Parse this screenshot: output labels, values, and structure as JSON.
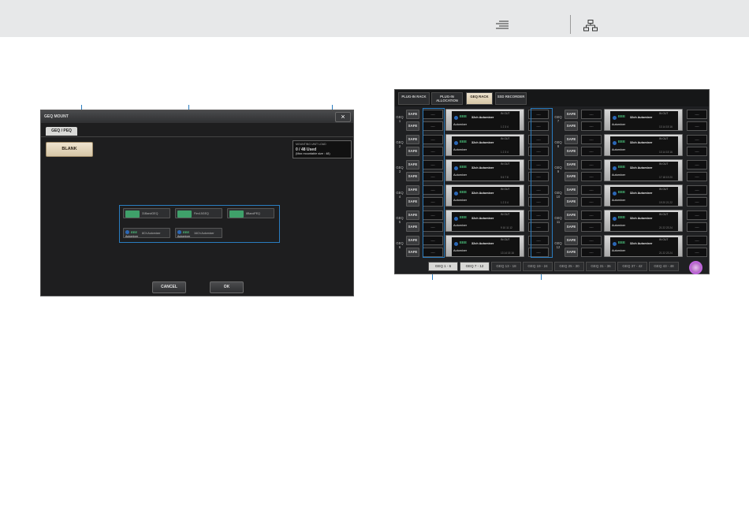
{
  "topbar": {
    "menu_icon": "list-indent-icon",
    "tree_icon": "hierarchy-icon"
  },
  "geq_mount": {
    "title": "GEQ MOUNT",
    "close_label": "×",
    "tab": "GEQ / PEQ",
    "blank_label": "BLANK",
    "resource": {
      "label": "MOUNTING UNIT LOAD",
      "used": "0 / 48 Used",
      "max": "(Max mountable size : 48)"
    },
    "chips": [
      {
        "logo": "GEQ 31",
        "label": "31BandGEQ"
      },
      {
        "logo": "GEQ Flex15",
        "label": "Flex15GEQ"
      },
      {
        "logo": "PEQ 8",
        "label": "8BandPEQ"
      },
      {
        "mini": "EEE",
        "label": "8Ch Automixer",
        "sub": "Automixer"
      },
      {
        "mini": "EEE",
        "label": "16Ch Automixer",
        "sub": "Automixer"
      }
    ],
    "cancel_label": "CANCEL",
    "ok_label": "OK"
  },
  "rack": {
    "tabs": [
      "PLUG-IN RACK",
      "PLUG-IN ALLOCATION",
      "GEQ RACK",
      "SSD RECORDER"
    ],
    "left_rows": [
      {
        "label": "GEQ 1",
        "chs": "1 2 3 4"
      },
      {
        "label": "GEQ 2",
        "chs": "1 2 3 4"
      },
      {
        "label": "GEQ 3",
        "chs": "5 6 7 8"
      },
      {
        "label": "GEQ 4",
        "chs": "1 2 3 4"
      },
      {
        "label": "GEQ 5",
        "chs": "9 10 11 12"
      },
      {
        "label": "GEQ 6",
        "chs": "13 14 15 16"
      }
    ],
    "right_rows": [
      {
        "label": "GEQ 7",
        "chs": "13 14 15 16"
      },
      {
        "label": "GEQ 8",
        "chs": "13 14 15 16"
      },
      {
        "label": "GEQ 9",
        "chs": "17 18 19 20"
      },
      {
        "label": "GEQ 10",
        "chs": "19 20 21 22"
      },
      {
        "label": "GEQ 11",
        "chs": "21 22 23 24"
      },
      {
        "label": "GEQ 12",
        "chs": "21 22 23 24"
      }
    ],
    "safe_label": "SAFE",
    "slot_label": "----",
    "unit_name": "32ch Automixer",
    "unit_sub": "Automixer",
    "unit_io": "IN  OUT",
    "mini": "EEE",
    "pages": [
      "GEQ 1 - 6",
      "GEQ 7 - 12",
      "GEQ 13 - 18",
      "GEQ 19 - 24",
      "GEQ 25 - 30",
      "GEQ 31 - 36",
      "GEQ 37 - 42",
      "GEQ 43 - 48"
    ]
  }
}
